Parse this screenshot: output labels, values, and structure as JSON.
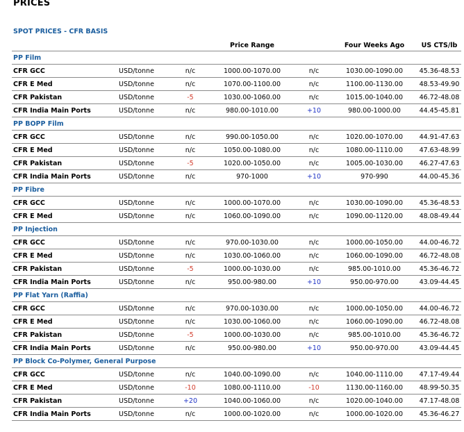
{
  "page": {
    "title": "PRICES",
    "subtitle": "SPOT PRICES - CFR BASIS"
  },
  "table": {
    "headers": [
      "",
      "",
      "",
      "Price Range",
      "",
      "Four Weeks Ago",
      "US CTS/lb"
    ],
    "sections": [
      {
        "name": "PP Film",
        "rows": [
          {
            "name": "CFR GCC",
            "unit": "USD/tonne",
            "chg": "n/c",
            "range": "1000.00-1070.00",
            "chg4": "n/c",
            "ago": "1030.00-1090.00",
            "cts": "45.36-48.53"
          },
          {
            "name": "CFR E Med",
            "unit": "USD/tonne",
            "chg": "n/c",
            "range": "1070.00-1100.00",
            "chg4": "n/c",
            "ago": "1100.00-1130.00",
            "cts": "48.53-49.90"
          },
          {
            "name": "CFR Pakistan",
            "unit": "USD/tonne",
            "chg": "-5",
            "range": "1030.00-1060.00",
            "chg4": "n/c",
            "ago": "1015.00-1040.00",
            "cts": "46.72-48.08"
          },
          {
            "name": "CFR India Main Ports",
            "unit": "USD/tonne",
            "chg": "n/c",
            "range": "980.00-1010.00",
            "chg4": "+10",
            "ago": "980.00-1000.00",
            "cts": "44.45-45.81"
          }
        ]
      },
      {
        "name": "PP BOPP Film",
        "rows": [
          {
            "name": "CFR GCC",
            "unit": "USD/tonne",
            "chg": "n/c",
            "range": "990.00-1050.00",
            "chg4": "n/c",
            "ago": "1020.00-1070.00",
            "cts": "44.91-47.63"
          },
          {
            "name": "CFR E Med",
            "unit": "USD/tonne",
            "chg": "n/c",
            "range": "1050.00-1080.00",
            "chg4": "n/c",
            "ago": "1080.00-1110.00",
            "cts": "47.63-48.99"
          },
          {
            "name": "CFR Pakistan",
            "unit": "USD/tonne",
            "chg": "-5",
            "range": "1020.00-1050.00",
            "chg4": "n/c",
            "ago": "1005.00-1030.00",
            "cts": "46.27-47.63"
          },
          {
            "name": "CFR India Main Ports",
            "unit": "USD/tonne",
            "chg": "n/c",
            "range": "970-1000",
            "chg4": "+10",
            "ago": "970-990",
            "cts": "44.00-45.36"
          }
        ]
      },
      {
        "name": "PP Fibre",
        "rows": [
          {
            "name": "CFR GCC",
            "unit": "USD/tonne",
            "chg": "n/c",
            "range": "1000.00-1070.00",
            "chg4": "n/c",
            "ago": "1030.00-1090.00",
            "cts": "45.36-48.53"
          },
          {
            "name": "CFR E Med",
            "unit": "USD/tonne",
            "chg": "n/c",
            "range": "1060.00-1090.00",
            "chg4": "n/c",
            "ago": "1090.00-1120.00",
            "cts": "48.08-49.44"
          }
        ]
      },
      {
        "name": "PP Injection",
        "rows": [
          {
            "name": "CFR GCC",
            "unit": "USD/tonne",
            "chg": "n/c",
            "range": "970.00-1030.00",
            "chg4": "n/c",
            "ago": "1000.00-1050.00",
            "cts": "44.00-46.72"
          },
          {
            "name": "CFR E Med",
            "unit": "USD/tonne",
            "chg": "n/c",
            "range": "1030.00-1060.00",
            "chg4": "n/c",
            "ago": "1060.00-1090.00",
            "cts": "46.72-48.08"
          },
          {
            "name": "CFR Pakistan",
            "unit": "USD/tonne",
            "chg": "-5",
            "range": "1000.00-1030.00",
            "chg4": "n/c",
            "ago": "985.00-1010.00",
            "cts": "45.36-46.72"
          },
          {
            "name": "CFR India Main Ports",
            "unit": "USD/tonne",
            "chg": "n/c",
            "range": "950.00-980.00",
            "chg4": "+10",
            "ago": "950.00-970.00",
            "cts": "43.09-44.45"
          }
        ]
      },
      {
        "name": "PP Flat Yarn (Raffia)",
        "rows": [
          {
            "name": "CFR GCC",
            "unit": "USD/tonne",
            "chg": "n/c",
            "range": "970.00-1030.00",
            "chg4": "n/c",
            "ago": "1000.00-1050.00",
            "cts": "44.00-46.72"
          },
          {
            "name": "CFR E Med",
            "unit": "USD/tonne",
            "chg": "n/c",
            "range": "1030.00-1060.00",
            "chg4": "n/c",
            "ago": "1060.00-1090.00",
            "cts": "46.72-48.08"
          },
          {
            "name": "CFR Pakistan",
            "unit": "USD/tonne",
            "chg": "-5",
            "range": "1000.00-1030.00",
            "chg4": "n/c",
            "ago": "985.00-1010.00",
            "cts": "45.36-46.72"
          },
          {
            "name": "CFR India Main Ports",
            "unit": "USD/tonne",
            "chg": "n/c",
            "range": "950.00-980.00",
            "chg4": "+10",
            "ago": "950.00-970.00",
            "cts": "43.09-44.45"
          }
        ]
      },
      {
        "name": "PP Block Co-Polymer, General Purpose",
        "rows": [
          {
            "name": "CFR GCC",
            "unit": "USD/tonne",
            "chg": "n/c",
            "range": "1040.00-1090.00",
            "chg4": "n/c",
            "ago": "1040.00-1110.00",
            "cts": "47.17-49.44"
          },
          {
            "name": "CFR E Med",
            "unit": "USD/tonne",
            "chg": "-10",
            "range": "1080.00-1110.00",
            "chg4": "-10",
            "ago": "1130.00-1160.00",
            "cts": "48.99-50.35"
          },
          {
            "name": "CFR Pakistan",
            "unit": "USD/tonne",
            "chg": "+20",
            "range": "1040.00-1060.00",
            "chg4": "n/c",
            "ago": "1020.00-1040.00",
            "cts": "47.17-48.08"
          },
          {
            "name": "CFR India Main Ports",
            "unit": "USD/tonne",
            "chg": "n/c",
            "range": "1000.00-1020.00",
            "chg4": "n/c",
            "ago": "1000.00-1020.00",
            "cts": "45.36-46.27"
          }
        ]
      }
    ]
  },
  "colors": {
    "section_heading": "#1a5d9e",
    "negative_change": "#d23a2a",
    "positive_change": "#1f33c6"
  }
}
